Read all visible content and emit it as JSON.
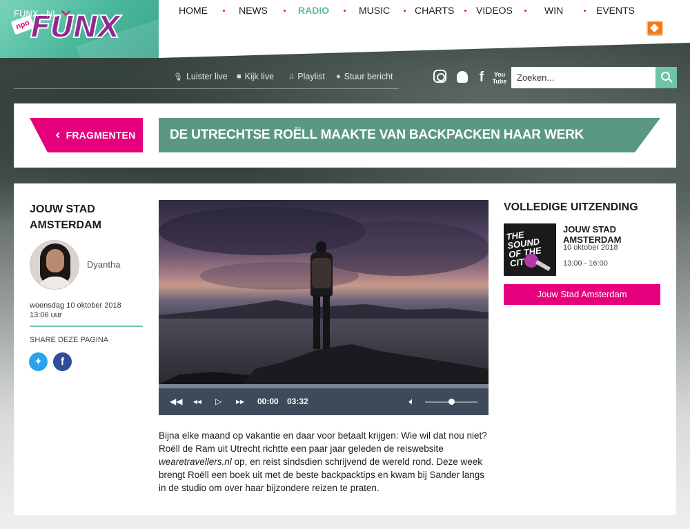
{
  "header": {
    "logo_prefix": "npo",
    "logo_text": "FUNX",
    "nav": [
      {
        "label": "HOME",
        "active": false
      },
      {
        "label": "NEWS",
        "active": false
      },
      {
        "label": "RADIO",
        "active": true
      },
      {
        "label": "MUSIC",
        "active": false
      },
      {
        "label": "CHARTS",
        "active": false
      },
      {
        "label": "VIDEOS",
        "active": false
      },
      {
        "label": "WIN",
        "active": false
      },
      {
        "label": "EVENTS",
        "active": false
      }
    ],
    "accent_color": "#e5007e",
    "active_color": "#5fb9a0"
  },
  "subbar": {
    "station": "FUNX - NL",
    "links": [
      {
        "label": "Luister live",
        "icon": "microphone-icon"
      },
      {
        "label": "Kijk live",
        "icon": "camera-icon"
      },
      {
        "label": "Playlist",
        "icon": "music-note-icon"
      },
      {
        "label": "Stuur bericht",
        "icon": "chat-icon"
      }
    ],
    "social": [
      "instagram-icon",
      "snapchat-icon",
      "facebook-icon",
      "youtube-icon"
    ],
    "youtube_top": "You",
    "youtube_bottom": "Tube",
    "search_placeholder": "Zoeken..."
  },
  "title_panel": {
    "back_label": "FRAGMENTEN",
    "title": "DE UTRECHTSE ROËLL MAAKTE VAN BACKPACKEN HAAR WERK"
  },
  "sidebar": {
    "show_title": "JOUW STAD AMSTERDAM",
    "presenter": "Dyantha",
    "date": "woensdag 10 oktober 2018",
    "time": "13:06 uur",
    "share_label": "SHARE DEZE PAGINA"
  },
  "player": {
    "current_time": "00:00",
    "duration": "03:32",
    "progress": 0,
    "volume": 0.5
  },
  "article": {
    "part1": "Bijna elke maand op vakantie en daar voor betaalt krijgen: Wie wil dat nou niet? Roëll de Ram uit Utrecht richtte een paar jaar geleden de reiswebsite ",
    "link": "wearetravellers.nl",
    "part2": " op, en reist sindsdien schrijvend de wereld rond. Deze week brengt Roëll een boek uit met de beste backpacktips en kwam bij Sander langs in de studio om over haar bijzondere reizen te praten."
  },
  "right": {
    "title": "VOLLEDIGE UITZENDING",
    "thumb_text": "THE SOUND OF THE CITY",
    "show_name": "JOUW STAD AMSTERDAM",
    "date": "10 oktober 2018",
    "time": "13:00 - 16:00",
    "button_label": "Jouw Stad Amsterdam"
  }
}
